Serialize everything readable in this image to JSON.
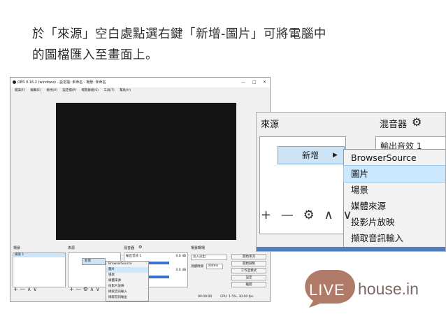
{
  "instruction": {
    "line1": "於「來源」空白處點選右鍵「新增-圖片」可將電腦中",
    "line2": "的圖檔匯入至畫面上。"
  },
  "obs": {
    "title": "OBS 0.16.2 (windows) - 設定檔: 未命名 - 場景: 未命名",
    "window_controls": [
      "—",
      "□",
      "✕"
    ],
    "menu": [
      "檔案(F)",
      "編輯(E)",
      "檢視(V)",
      "設定檔(P)",
      "場景群組(S)",
      "工具(T)",
      "幫助(H)"
    ],
    "panels": {
      "scenes": "場景",
      "sources": "來源",
      "mixer": "混音器",
      "transitions": "場景轉場"
    },
    "scene_item": "場景 1",
    "context_add": "新增",
    "context_items": [
      "BrowserSource",
      "圖片",
      "場景",
      "媒體來源",
      "投影片放映",
      "擷取音訊輸入",
      "擷取音訊輸出"
    ],
    "mixer_items": [
      {
        "label": "輸出音效 1",
        "value": "0.0 dB"
      },
      {
        "label": "麥克風",
        "value": "0.0 dB"
      }
    ],
    "transition_select": "淡入淡出",
    "duration_label": "持續時間",
    "duration_value": "300ms",
    "buttons": [
      "開始串流",
      "開始錄製",
      "工作室模式",
      "設定",
      "離開"
    ],
    "status": {
      "time": "00:00:00",
      "cpu": "CPU: 1.5%, 30.00 fps"
    }
  },
  "zoom": {
    "sources_label": "來源",
    "mixer_label": "混音器",
    "mixer_item": "輸出音效 1",
    "add_label": "新增",
    "submenu": [
      "BrowserSource",
      "圖片",
      "場景",
      "媒體來源",
      "投影片放映",
      "擷取音訊輸入"
    ],
    "tools": [
      "+",
      "—",
      "⚙",
      "∧",
      "∨"
    ]
  },
  "logo": {
    "bubble": "LIVE",
    "text": "house.in"
  },
  "colors": {
    "selection": "#cce8ff",
    "logo_bubble": "#b07a68",
    "logo_text": "#7a6a63"
  }
}
